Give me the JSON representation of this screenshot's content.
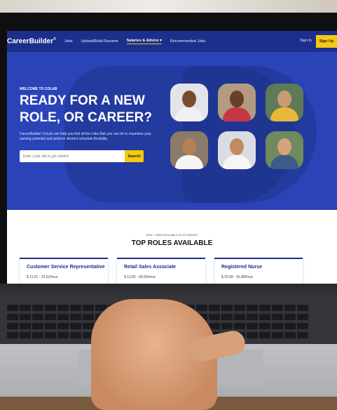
{
  "nav": {
    "logo": "CareerBuilder",
    "logo_mark": "®",
    "links": [
      "Jobs",
      "Upload/Build Resume",
      "Salaries & Advice ▾",
      "Recommended Jobs"
    ],
    "sign_in": "Sign In",
    "sign_up": "Sign Up"
  },
  "hero": {
    "eyebrow": "WELCOME TO COLAB",
    "headline": "READY FOR A NEW ROLE, OR CAREER?",
    "description": "CareerBuilder CoLab can help you find all the roles that you can do to maximize your earning potential and achieve desired schedule flexibility.",
    "search_placeholder": "Enter a job role to get started",
    "search_button": "Search"
  },
  "roles": {
    "subheading": "300K+ JOBS AVAILABLE IN US MARKET",
    "title": "TOP ROLES AVAILABLE",
    "cards": [
      {
        "title": "Customer Service Representative",
        "pay": "$ 11.01 - 29.62/hour"
      },
      {
        "title": "Retail Sales Associate",
        "pay": "$ 12.83 - 59.65/hour"
      },
      {
        "title": "Registered Nurse",
        "pay": "$ 25.68 - 55.88/hour"
      }
    ]
  },
  "colors": {
    "brand": "#1d2f8c",
    "hero": "#2a44b8",
    "accent": "#f6c811"
  }
}
